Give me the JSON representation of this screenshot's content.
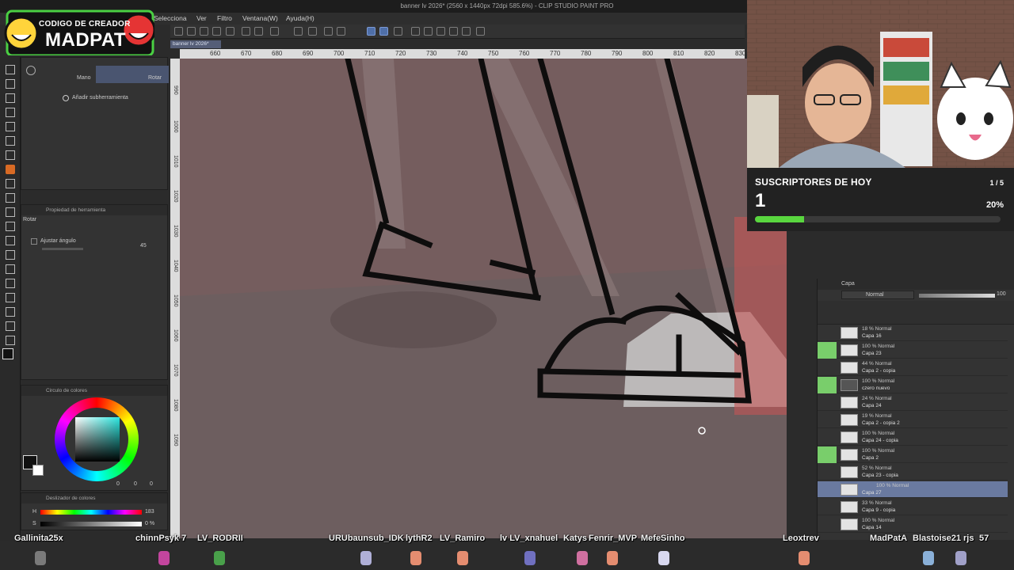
{
  "window": {
    "title": "banner lv 2026* (2560 x 1440px 72dpi 585.6%) - CLIP STUDIO PAINT PRO",
    "canvas_tab": "banner lv 2026*"
  },
  "menu": {
    "items": [
      "Selecciona",
      "Ver",
      "Filtro",
      "Ventana(W)",
      "Ayuda(H)"
    ]
  },
  "overlay_logo": {
    "line1": "CODIGO DE CREADOR",
    "line2": "MADPAT"
  },
  "tool_property": {
    "subtool_label_hand": "Mano",
    "subtool_label_rotate": "Rotar",
    "add_subtool": "Añadir subherramienta",
    "panel_title": "Propiedad de herramienta",
    "current_tool": "Rotar",
    "snap_label": "Ajustar ángulo",
    "angle_value": "45"
  },
  "color_circle": {
    "title": "Circulo de colores",
    "values": [
      "0",
      "0",
      "0"
    ]
  },
  "color_slider": {
    "title": "Deslizador de colores",
    "h_label": "H",
    "h_value": "183",
    "s_label": "S",
    "s_value": "0 %"
  },
  "ruler": {
    "top": [
      "660",
      "670",
      "680",
      "690",
      "700",
      "710",
      "720",
      "730",
      "740",
      "750",
      "760",
      "770",
      "780",
      "790",
      "800",
      "810",
      "820",
      "830"
    ],
    "left": [
      "990",
      "1000",
      "1010",
      "1020",
      "1030",
      "1040",
      "1050",
      "1060",
      "1070",
      "1080",
      "1090"
    ]
  },
  "subs_widget": {
    "title": "SUSCRIPTORES DE HOY",
    "count": "1",
    "ratio": "1 / 5",
    "percent": "20%",
    "progress": 0.2,
    "accent": "#59d63f"
  },
  "layers_panel": {
    "tab": "Capa",
    "blend_mode": "Normal",
    "opacity": "100",
    "rows": [
      {
        "mode": "18 % Normal",
        "name": "Capa 16",
        "visible": false
      },
      {
        "mode": "100 % Normal",
        "name": "Capa 23",
        "visible": true
      },
      {
        "mode": "44 % Normal",
        "name": "Capa 2 - copia",
        "visible": false
      },
      {
        "mode": "100 % Normal",
        "name": "czero nuevo",
        "visible": true
      },
      {
        "mode": "24 % Normal",
        "name": "Capa 24",
        "visible": false
      },
      {
        "mode": "19 % Normal",
        "name": "Capa 2 - copia 2",
        "visible": false
      },
      {
        "mode": "100 % Normal",
        "name": "Capa 24 - copia",
        "visible": false
      },
      {
        "mode": "100 % Normal",
        "name": "Capa 2",
        "visible": true
      },
      {
        "mode": "52 % Normal",
        "name": "Capa 23 - copia",
        "visible": false
      },
      {
        "mode": "100 % Normal",
        "name": "Capa 27",
        "visible": false,
        "selected": true
      },
      {
        "mode": "33 % Normal",
        "name": "Capa 9 - copia",
        "visible": false
      },
      {
        "mode": "100 % Normal",
        "name": "Capa 14",
        "visible": false
      }
    ]
  },
  "chat_names": [
    "Gallinita25x",
    "chinnPsyk 7",
    "LV_RODRII",
    "URUbaunsub_IDK",
    "lythR2",
    "LV_Ramiro",
    "lv LV_xnahuel",
    "Katys",
    "Fenrir_MVP",
    "MefeSinho",
    "Leoxtrev",
    "MadPatA",
    "Blastoise21",
    "rjs",
    "57"
  ]
}
